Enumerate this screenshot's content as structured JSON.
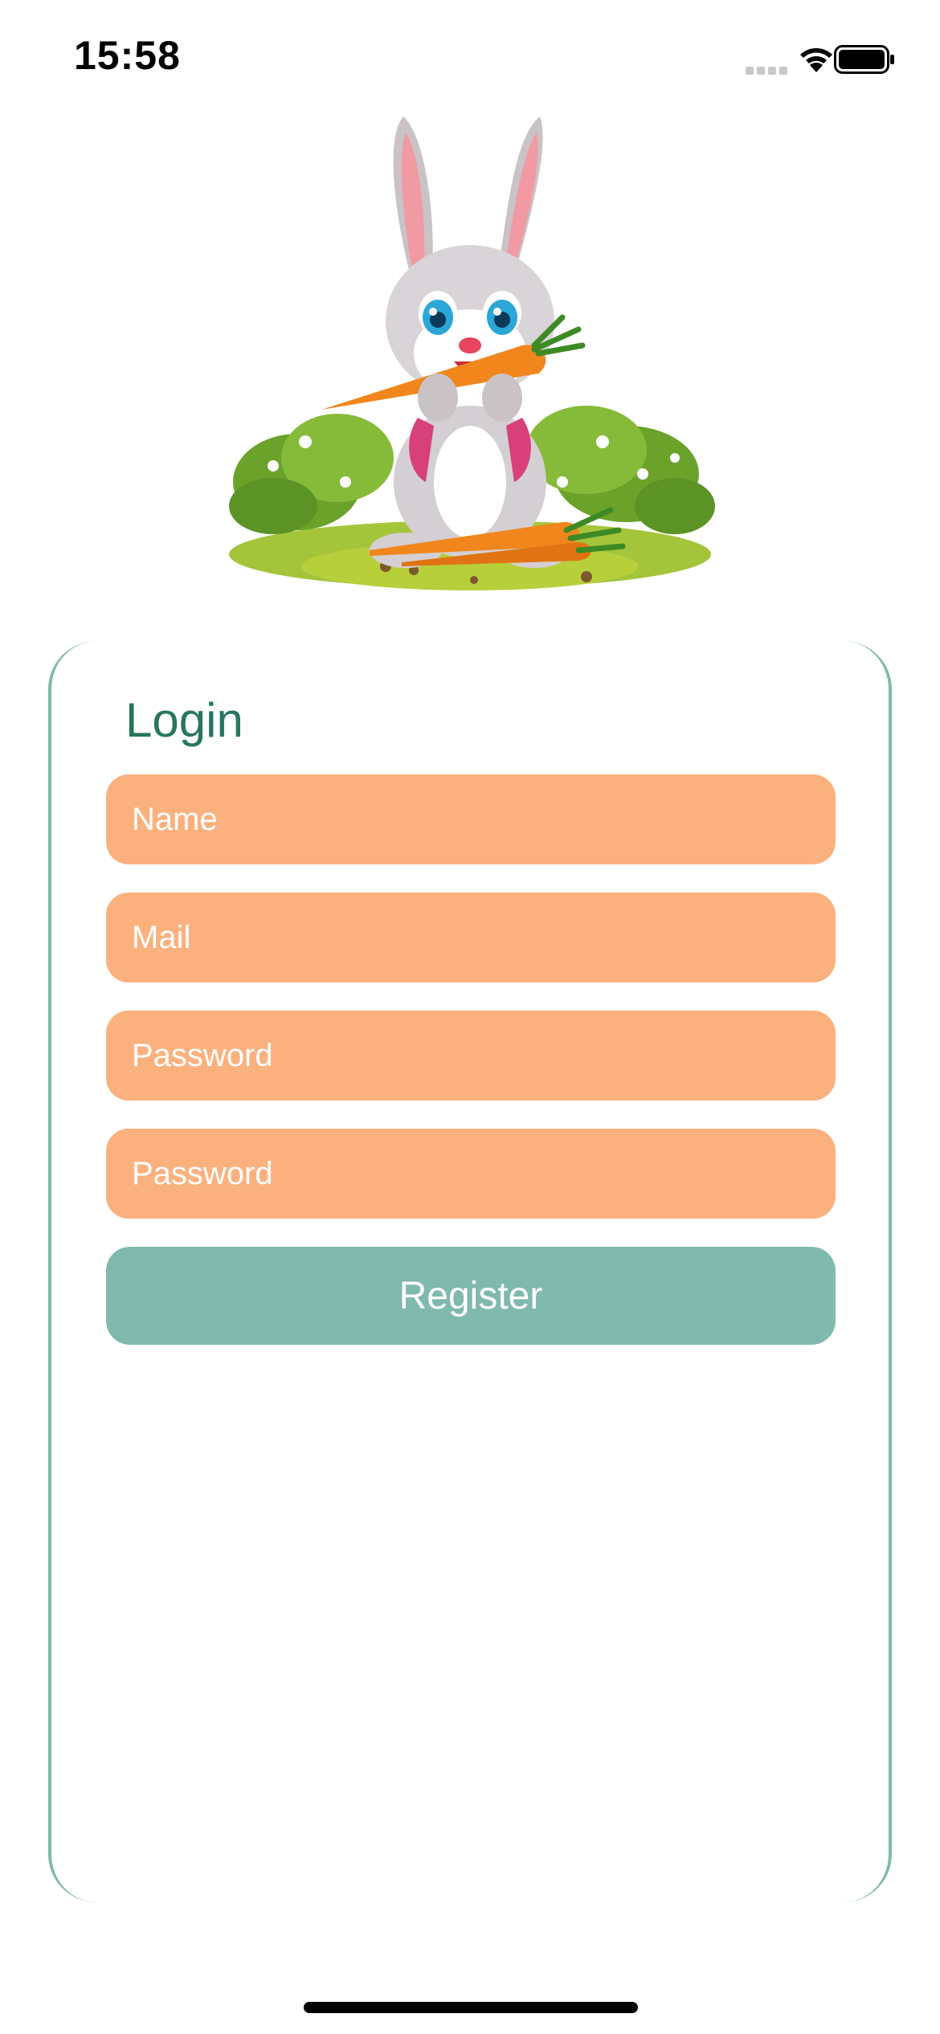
{
  "status_bar": {
    "time": "15:58"
  },
  "form": {
    "title": "Login",
    "name_placeholder": "Name",
    "mail_placeholder": "Mail",
    "password_placeholder": "Password",
    "password_confirm_placeholder": "Password",
    "register_label": "Register"
  },
  "colors": {
    "accent": "#80b9ad",
    "title": "#26765f",
    "field_bg": "#fbb17e"
  },
  "icons": [
    "cellular-signal-icon",
    "wifi-icon",
    "battery-icon"
  ]
}
